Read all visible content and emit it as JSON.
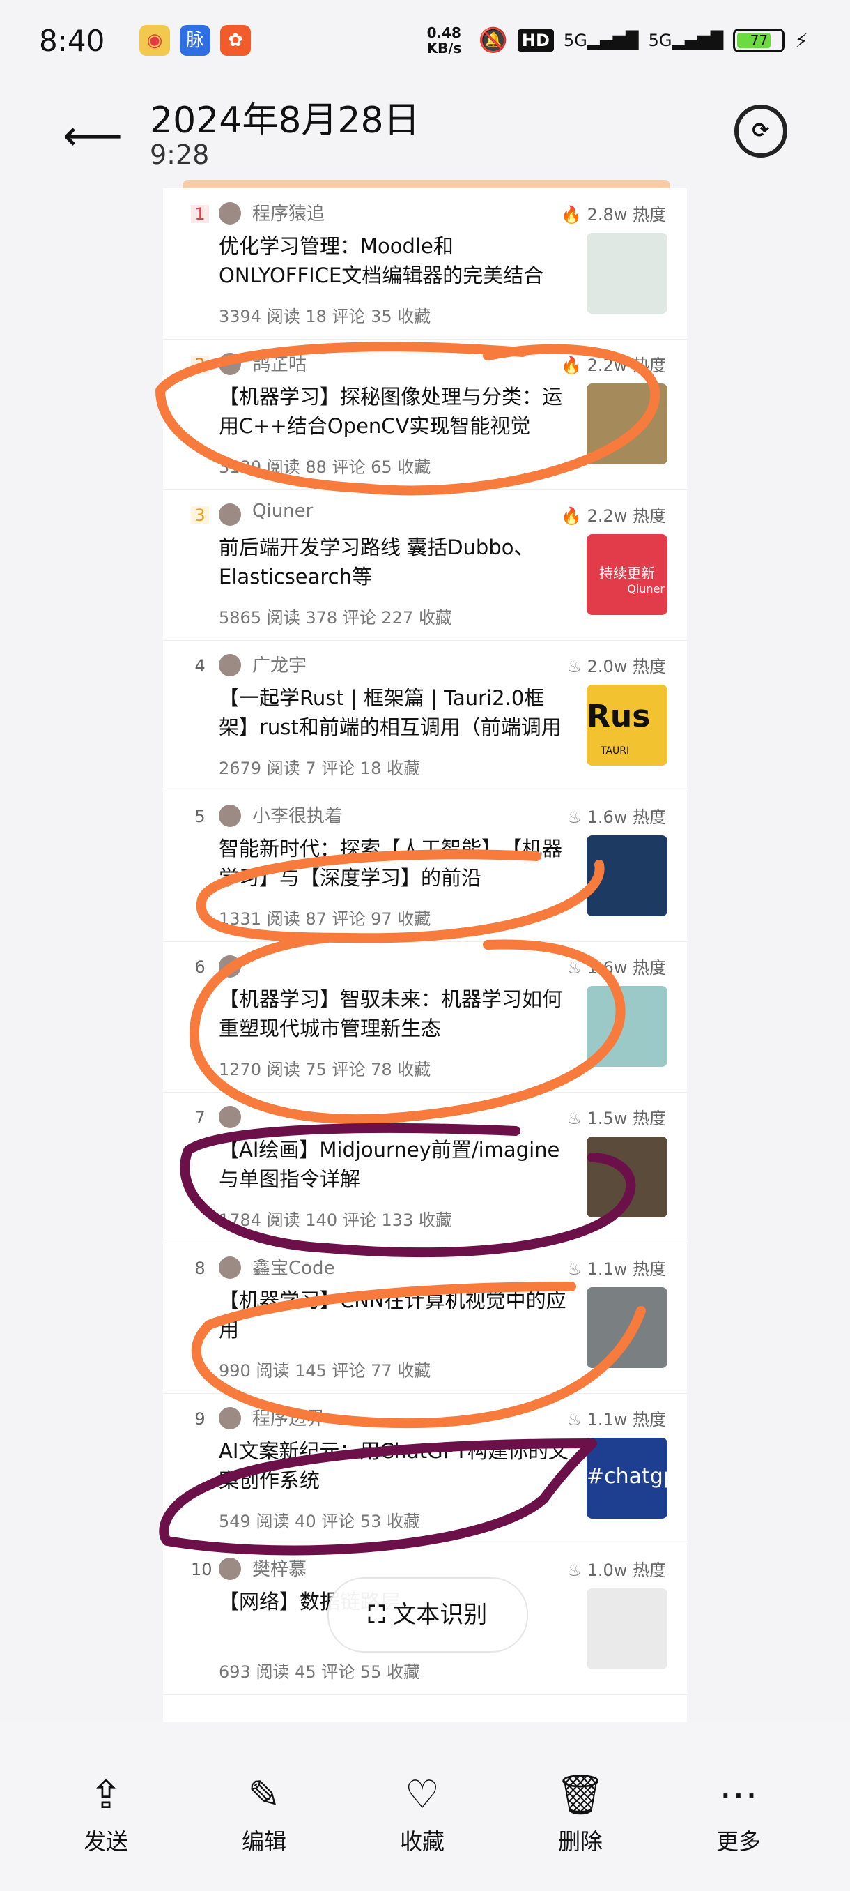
{
  "status_bar": {
    "time": "8:40",
    "net_speed": "0.48 KB/s",
    "hd": "HD",
    "sig1": "5G",
    "sig2": "5G",
    "battery": "77",
    "battery_level": 0.77
  },
  "header": {
    "date": "2024年8月28日",
    "time": "9:28"
  },
  "items": [
    {
      "rank": "1",
      "author": "程序猿追",
      "heat": "2.8w 热度",
      "title": "优化学习管理：Moodle和ONLYOFFICE文档编辑器的完美结合",
      "meta": "3394 阅读 18 评论 35 收藏",
      "hot": true
    },
    {
      "rank": "2",
      "author": "鸽芷咕",
      "heat": "2.2w 热度",
      "title": "【机器学习】探秘图像处理与分类：运用C++结合OpenCV实现智能视觉",
      "meta": "3130 阅读 88 评论 65 收藏",
      "hot": true
    },
    {
      "rank": "3",
      "author": "Qiuner",
      "heat": "2.2w 热度",
      "title": "前后端开发学习路线 囊括Dubbo、Elasticsearch等",
      "meta": "5865 阅读 378 评论 227 收藏",
      "hot": true
    },
    {
      "rank": "4",
      "author": "广龙宇",
      "heat": "2.0w 热度",
      "title": "【一起学Rust | 框架篇 | Tauri2.0框架】rust和前端的相互调用（前端调用",
      "meta": "2679 阅读 7 评论 18 收藏",
      "hot": false
    },
    {
      "rank": "5",
      "author": "小李很执着",
      "heat": "1.6w 热度",
      "title": "智能新时代：探索【人工智能】、【机器学习】与【深度学习】的前沿",
      "meta": "1331 阅读 87 评论 97 收藏",
      "hot": false
    },
    {
      "rank": "6",
      "author": "",
      "heat": "1.6w 热度",
      "title": "【机器学习】智驭未来：机器学习如何重塑现代城市管理新生态",
      "meta": "1270 阅读 75 评论 78 收藏",
      "hot": false
    },
    {
      "rank": "7",
      "author": "",
      "heat": "1.5w 热度",
      "title": "【AI绘画】Midjourney前置/imagine与单图指令详解",
      "meta": "1784 阅读 140 评论 133 收藏",
      "hot": false
    },
    {
      "rank": "8",
      "author": "鑫宝Code",
      "heat": "1.1w 热度",
      "title": "【机器学习】CNN在计算机视觉中的应用",
      "meta": "990 阅读 145 评论 77 收藏",
      "hot": false
    },
    {
      "rank": "9",
      "author": "程序边界",
      "heat": "1.1w 热度",
      "title": "AI文案新纪元：用ChatGPT构建你的文案创作系统",
      "meta": "549 阅读 40 评论 53 收藏",
      "hot": false
    },
    {
      "rank": "10",
      "author": "樊梓慕",
      "heat": "1.0w 热度",
      "title": "【网络】数据链路层",
      "meta": "693 阅读 45 评论 55 收藏",
      "hot": false
    }
  ],
  "thumbs": {
    "t3_text1": "持续更新",
    "t3_text2": "Qiuner",
    "t4_text": "Rus",
    "t4_sub": "TAURI",
    "t9_text": "#chatgp"
  },
  "ocr_button": "文本识别",
  "bottom_bar": [
    {
      "label": "发送",
      "icon": "share-icon"
    },
    {
      "label": "编辑",
      "icon": "edit-icon"
    },
    {
      "label": "收藏",
      "icon": "heart-icon"
    },
    {
      "label": "删除",
      "icon": "trash-icon"
    },
    {
      "label": "更多",
      "icon": "more-icon"
    }
  ],
  "colors": {
    "orange_marker": "#f77b3c",
    "purple_marker": "#6b1048"
  }
}
